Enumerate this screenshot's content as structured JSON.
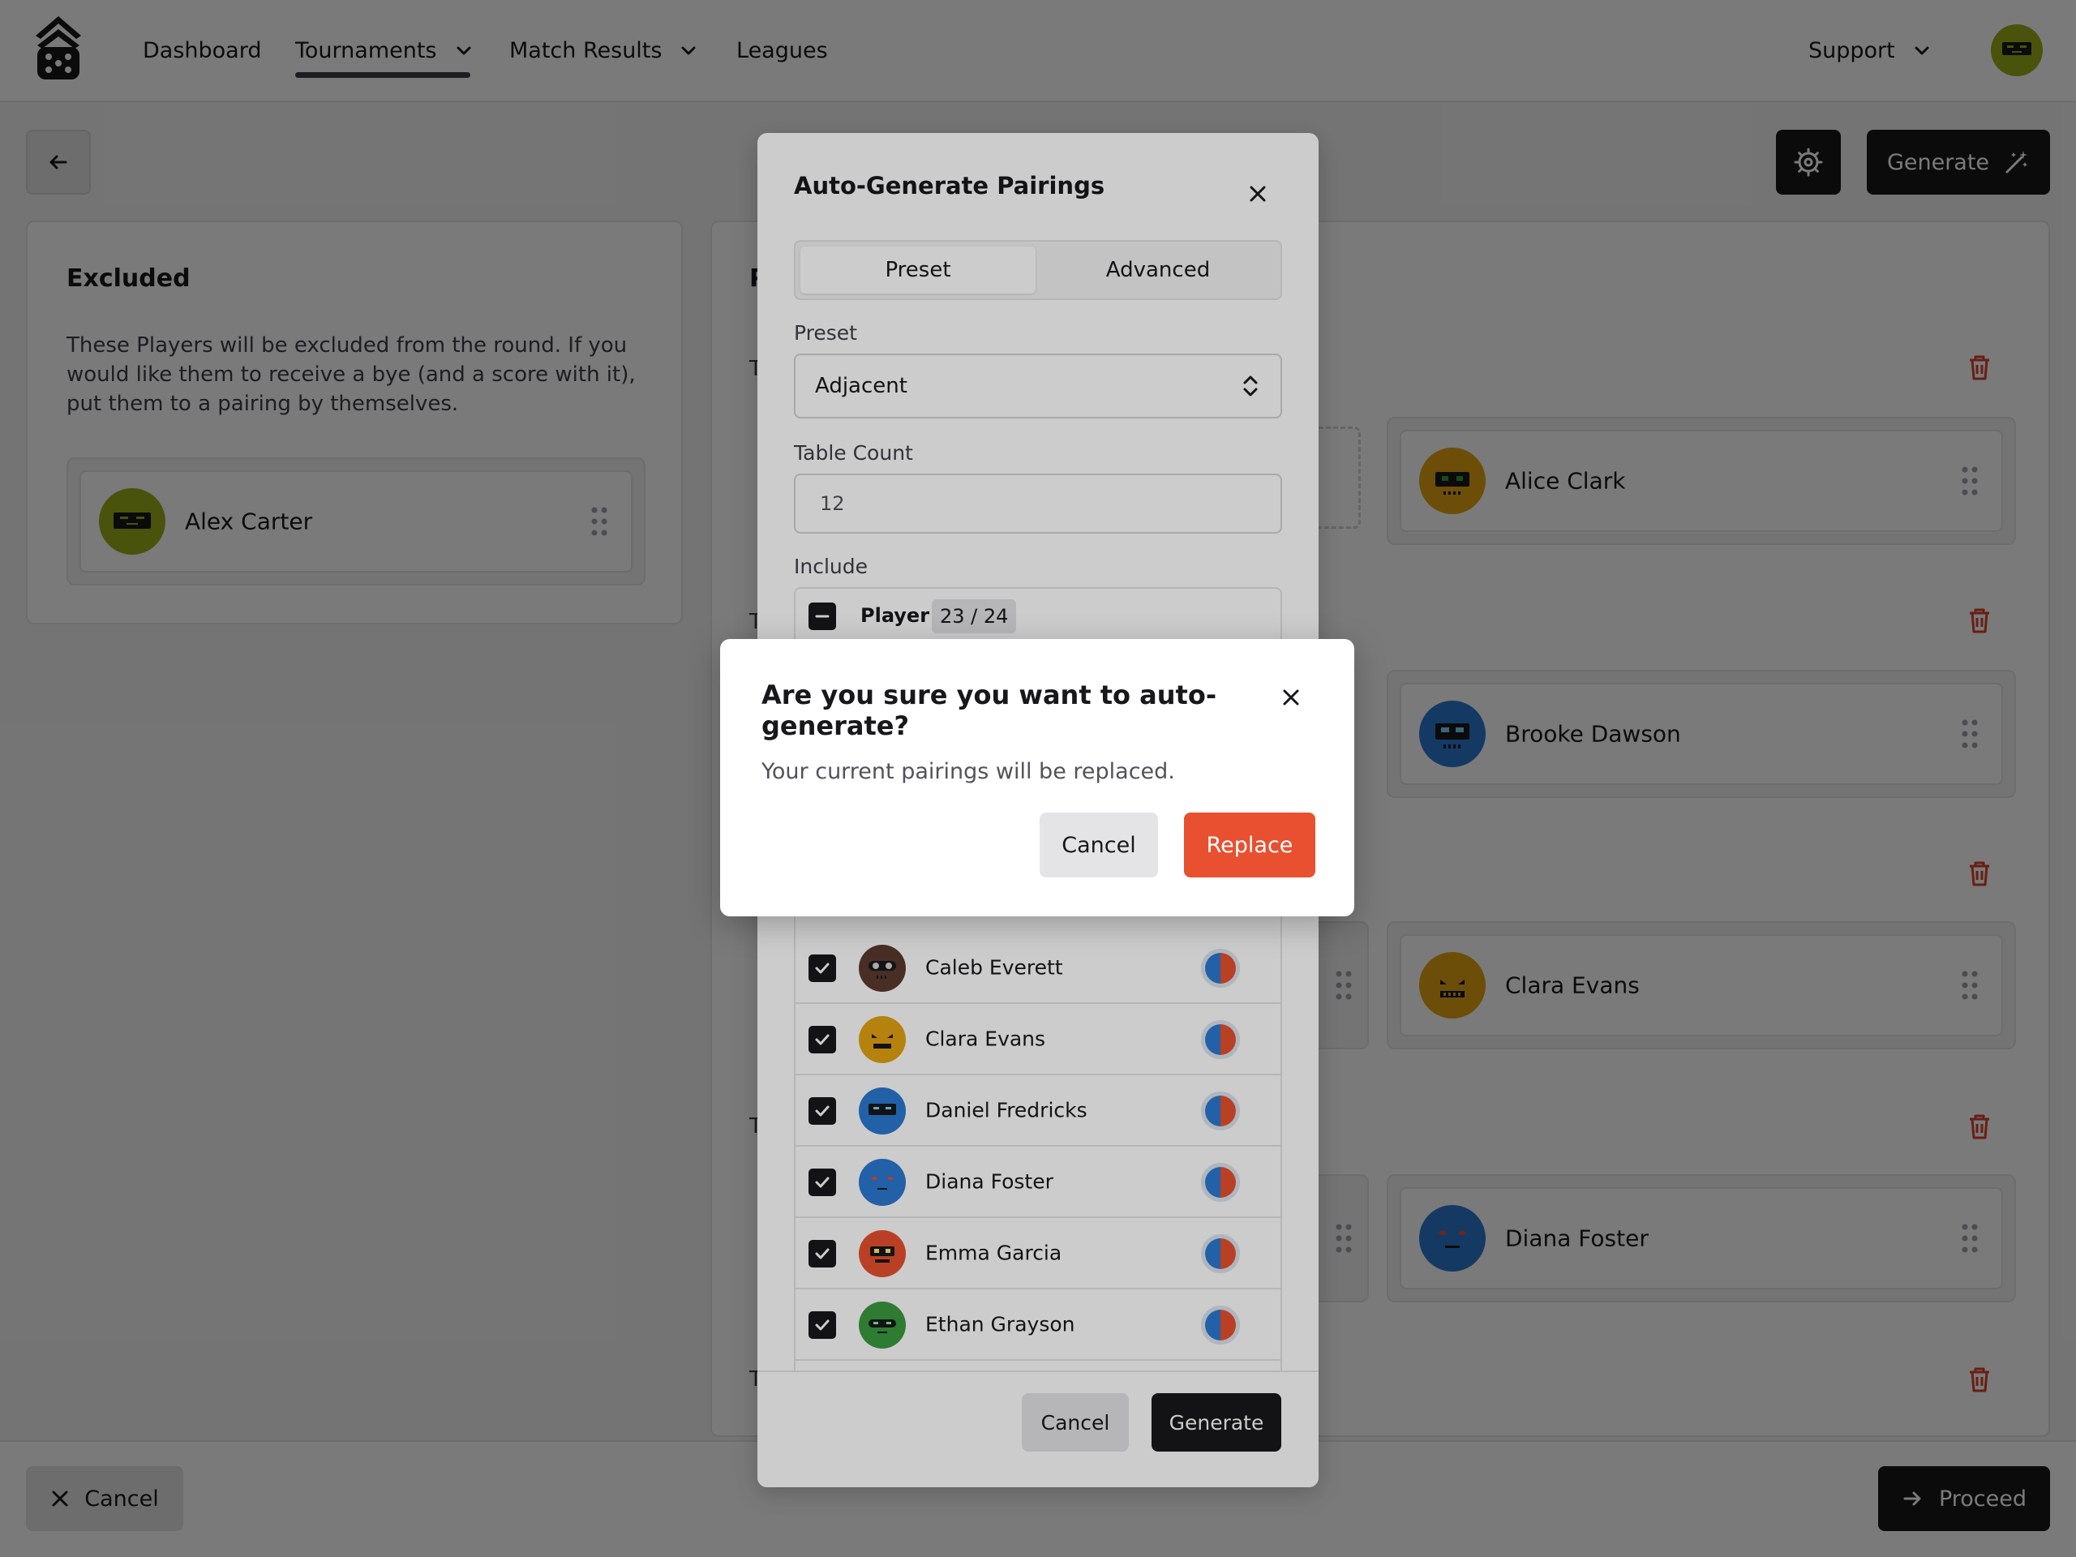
{
  "nav": {
    "items": [
      {
        "label": "Dashboard"
      },
      {
        "label": "Tournaments"
      },
      {
        "label": "Match Results"
      },
      {
        "label": "Leagues"
      }
    ],
    "support_label": "Support"
  },
  "toolbar": {
    "generate_label": "Generate"
  },
  "excluded": {
    "title": "Excluded",
    "description": "These Players will be excluded from the round. If you would like them to receive a bye (and a score with it), put them to a pairing by themselves.",
    "players": [
      {
        "name": "Alex Carter",
        "avatar_color": "#9bad1c"
      }
    ]
  },
  "pairings": {
    "heading_initial": "P",
    "table_initial": "T",
    "right_players": [
      {
        "name": "Alice Clark",
        "avatar_color": "#e3a312"
      },
      {
        "name": "Brooke Dawson",
        "avatar_color": "#2b7ad1"
      },
      {
        "name": "Clara Evans",
        "avatar_color": "#e3a312"
      },
      {
        "name": "Diana Foster",
        "avatar_color": "#2b7ad1"
      }
    ]
  },
  "bottom": {
    "cancel_label": "Cancel",
    "proceed_label": "Proceed"
  },
  "auto_generate_modal": {
    "title": "Auto-Generate Pairings",
    "tabs": [
      {
        "label": "Preset"
      },
      {
        "label": "Advanced"
      }
    ],
    "preset_label": "Preset",
    "preset_value": "Adjacent",
    "table_count_label": "Table Count",
    "table_count_placeholder": "12",
    "include_label": "Include",
    "include_column": "Player",
    "include_count": "23 / 24",
    "players": [
      {
        "name": "Caleb Everett",
        "avatar_color": "#5a3a2e"
      },
      {
        "name": "Clara Evans",
        "avatar_color": "#e3a312"
      },
      {
        "name": "Daniel Fredricks",
        "avatar_color": "#2b7ad1"
      },
      {
        "name": "Diana Foster",
        "avatar_color": "#2b7ad1"
      },
      {
        "name": "Emma Garcia",
        "avatar_color": "#e8502f"
      },
      {
        "name": "Ethan Grayson",
        "avatar_color": "#3a9a3f"
      }
    ],
    "cancel_label": "Cancel",
    "generate_label": "Generate"
  },
  "confirm_dialog": {
    "title": "Are you sure you want to auto-generate?",
    "message": "Your current pairings will be replaced.",
    "cancel_label": "Cancel",
    "replace_label": "Replace"
  },
  "colors": {
    "accent_red": "#e8502f",
    "dark": "#18181b",
    "trash_red": "#d9412b"
  }
}
